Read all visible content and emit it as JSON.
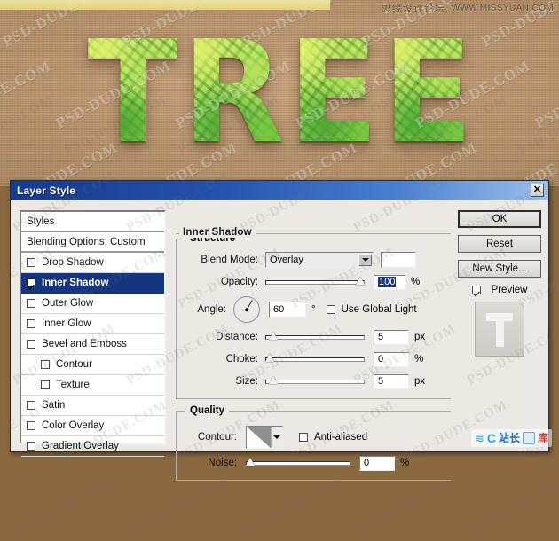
{
  "artwork": {
    "word": "TREE",
    "letters": [
      "T",
      "R",
      "E",
      "E"
    ],
    "watermark_text": "PSD-DUDE.COM",
    "top_watermark_cn": "思缘设计论坛",
    "top_watermark_url": "WWW.MISSYUAN.COM",
    "background_color": "#b08d67",
    "leaf_green": "#7cc634"
  },
  "dialog": {
    "title": "Layer Style",
    "close_label": "✕",
    "titlebar_color": "#173a8c",
    "background_color": "#ece9e4"
  },
  "styles_list": {
    "header": "Styles",
    "blending_options": "Blending Options: Custom",
    "items": [
      {
        "label": "Drop Shadow",
        "checked": false,
        "selected": false,
        "indent": false
      },
      {
        "label": "Inner Shadow",
        "checked": true,
        "selected": true,
        "indent": false
      },
      {
        "label": "Outer Glow",
        "checked": false,
        "selected": false,
        "indent": false
      },
      {
        "label": "Inner Glow",
        "checked": false,
        "selected": false,
        "indent": false
      },
      {
        "label": "Bevel and Emboss",
        "checked": false,
        "selected": false,
        "indent": false
      },
      {
        "label": "Contour",
        "checked": false,
        "selected": false,
        "indent": true
      },
      {
        "label": "Texture",
        "checked": false,
        "selected": false,
        "indent": true
      },
      {
        "label": "Satin",
        "checked": false,
        "selected": false,
        "indent": false
      },
      {
        "label": "Color Overlay",
        "checked": false,
        "selected": false,
        "indent": false
      },
      {
        "label": "Gradient Overlay",
        "checked": false,
        "selected": false,
        "indent": false
      }
    ]
  },
  "panel": {
    "title": "Inner Shadow",
    "structure": {
      "legend": "Structure",
      "blend_mode_label": "Blend Mode:",
      "blend_mode_value": "Overlay",
      "color_swatch": "#ffffff",
      "opacity_label": "Opacity:",
      "opacity_value": "100",
      "opacity_unit": "%",
      "opacity_percent": 100,
      "angle_label": "Angle:",
      "angle_value": "60",
      "angle_unit": "°",
      "angle_degrees": 60,
      "use_global_light_label": "Use Global Light",
      "use_global_light_checked": false,
      "distance_label": "Distance:",
      "distance_value": "5",
      "distance_unit": "px",
      "distance_percent": 4,
      "choke_label": "Choke:",
      "choke_value": "0",
      "choke_unit": "%",
      "choke_percent": 0,
      "size_label": "Size:",
      "size_value": "5",
      "size_unit": "px",
      "size_percent": 4
    },
    "quality": {
      "legend": "Quality",
      "contour_label": "Contour:",
      "anti_aliased_label": "Anti-aliased",
      "anti_aliased_checked": false,
      "noise_label": "Noise:",
      "noise_value": "0",
      "noise_unit": "%",
      "noise_percent": 0
    }
  },
  "buttons": {
    "ok": "OK",
    "reset": "Reset",
    "new_style": "New Style...",
    "preview_label": "Preview",
    "preview_checked": true
  },
  "site_logo": {
    "c": "C",
    "cn": "站长",
    "tail": "库"
  }
}
